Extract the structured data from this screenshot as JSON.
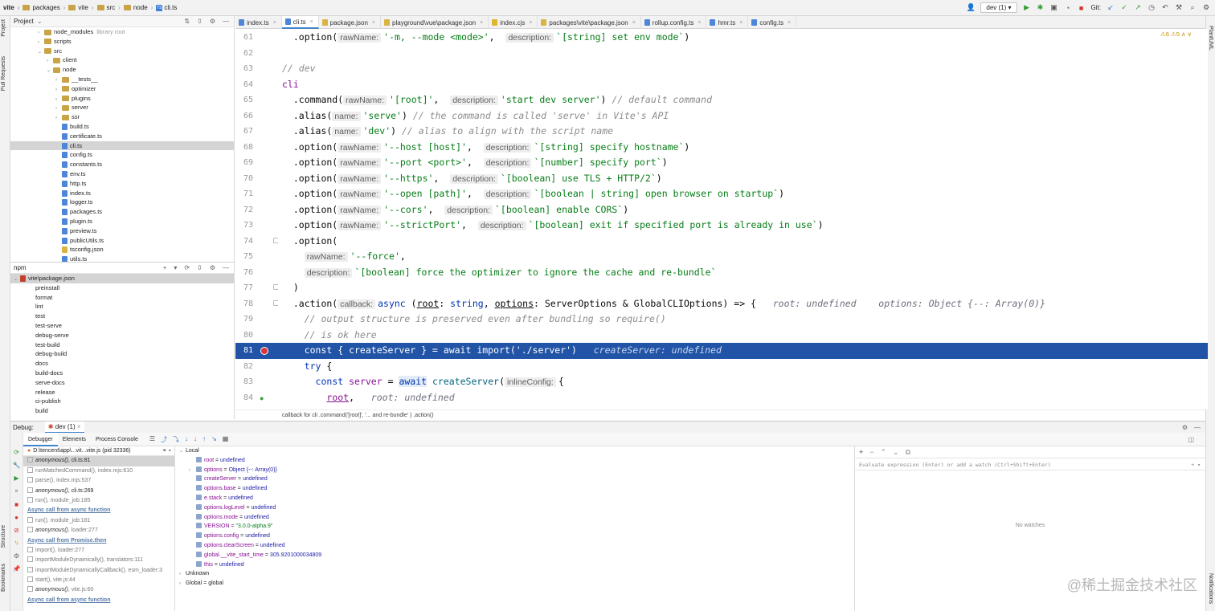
{
  "breadcrumb": [
    "vite",
    "packages",
    "vite",
    "src",
    "node",
    "cli.ts"
  ],
  "run_config": "dev (1)",
  "git_label": "Git:",
  "left_strip": {
    "project": "Project",
    "pull_requests": "Pull Requests",
    "structure": "Structure",
    "bookmarks": "Bookmarks"
  },
  "right_strip": {
    "plantuml": "PlantUML",
    "notifications": "Notifications"
  },
  "project_panel": {
    "title": "Project",
    "rows": [
      {
        "label": "node_modules",
        "extra": "library root",
        "depth": 4,
        "type": "folder",
        "arrow": "›"
      },
      {
        "label": "scripts",
        "depth": 4,
        "type": "folder",
        "arrow": "›"
      },
      {
        "label": "src",
        "depth": 4,
        "type": "folder",
        "arrow": "⌄"
      },
      {
        "label": "client",
        "depth": 5,
        "type": "folder",
        "arrow": "›"
      },
      {
        "label": "node",
        "depth": 5,
        "type": "folder",
        "arrow": "⌄"
      },
      {
        "label": "__tests__",
        "depth": 6,
        "type": "folder",
        "arrow": "›"
      },
      {
        "label": "optimizer",
        "depth": 6,
        "type": "folder",
        "arrow": "›"
      },
      {
        "label": "plugins",
        "depth": 6,
        "type": "folder",
        "arrow": "›"
      },
      {
        "label": "server",
        "depth": 6,
        "type": "folder",
        "arrow": "›"
      },
      {
        "label": "ssr",
        "depth": 6,
        "type": "folder",
        "arrow": "›"
      },
      {
        "label": "build.ts",
        "depth": 6,
        "type": "ts"
      },
      {
        "label": "certificate.ts",
        "depth": 6,
        "type": "ts"
      },
      {
        "label": "cli.ts",
        "depth": 6,
        "type": "ts",
        "selected": true
      },
      {
        "label": "config.ts",
        "depth": 6,
        "type": "ts"
      },
      {
        "label": "constants.ts",
        "depth": 6,
        "type": "ts"
      },
      {
        "label": "env.ts",
        "depth": 6,
        "type": "ts"
      },
      {
        "label": "http.ts",
        "depth": 6,
        "type": "ts"
      },
      {
        "label": "index.ts",
        "depth": 6,
        "type": "ts"
      },
      {
        "label": "logger.ts",
        "depth": 6,
        "type": "ts"
      },
      {
        "label": "packages.ts",
        "depth": 6,
        "type": "ts"
      },
      {
        "label": "plugin.ts",
        "depth": 6,
        "type": "ts"
      },
      {
        "label": "preview.ts",
        "depth": 6,
        "type": "ts"
      },
      {
        "label": "publicUtils.ts",
        "depth": 6,
        "type": "ts"
      },
      {
        "label": "tsconfig.json",
        "depth": 6,
        "type": "json"
      },
      {
        "label": "utils.ts",
        "depth": 6,
        "type": "ts"
      }
    ]
  },
  "npm_panel": {
    "title": "npm",
    "root": "vite\\package.json",
    "scripts": [
      "preinstall",
      "format",
      "lint",
      "test",
      "test-serve",
      "debug-serve",
      "test-build",
      "debug-build",
      "docs",
      "build-docs",
      "serve-docs",
      "release",
      "ci-publish",
      "build"
    ]
  },
  "tabs": [
    {
      "label": "index.ts",
      "icon": "ts"
    },
    {
      "label": "cli.ts",
      "icon": "ts",
      "active": true
    },
    {
      "label": "package.json",
      "icon": "json"
    },
    {
      "label": "playground\\vue\\package.json",
      "icon": "json"
    },
    {
      "label": "index.cjs",
      "icon": "js"
    },
    {
      "label": "packages\\vite\\package.json",
      "icon": "json"
    },
    {
      "label": "rollup.config.ts",
      "icon": "ts"
    },
    {
      "label": "hmr.ts",
      "icon": "ts"
    },
    {
      "label": "config.ts",
      "icon": "ts"
    }
  ],
  "editor": {
    "warnings": "⚠6  ⚠5  ∧  ∨",
    "line_numbers": [
      "61",
      "62",
      "63",
      "64",
      "65",
      "66",
      "67",
      "68",
      "69",
      "70",
      "71",
      "72",
      "73",
      "74",
      "75",
      "76",
      "77",
      "78",
      "79",
      "80",
      "81",
      "82",
      "83",
      "84"
    ],
    "breakpoint_line": "81",
    "breadcrumb_footer": "callback for cli .command('[root]', '... and re-bundle' ) .action()"
  },
  "debug": {
    "label": "Debug:",
    "session": "dev (1)",
    "tabs": [
      "Debugger",
      "Elements",
      "Process Console"
    ],
    "thread": "D:\\tencent\\app\\...vit...vite.js (pid 32336)",
    "frames": [
      {
        "fn": "anonymous()",
        "loc": ", cli.ts:81",
        "italic": true,
        "current": true
      },
      {
        "fn": "runMatchedCommand()",
        "loc": ", index.mjs:610"
      },
      {
        "fn": "parse()",
        "loc": ", index.mjs:537"
      },
      {
        "fn": "anonymous()",
        "loc": ", cli.ts:269",
        "italic": true,
        "dark": true
      },
      {
        "fn": "run()",
        "loc": ", module_job:185"
      },
      {
        "async": "Async call from async function"
      },
      {
        "fn": "run()",
        "loc": ", module_job:181"
      },
      {
        "fn": "anonymous()",
        "loc": ", loader:277",
        "italic": true
      },
      {
        "async": "Async call from Promise.then"
      },
      {
        "fn": "import()",
        "loc": ", loader:277"
      },
      {
        "fn": "importModuleDynamically()",
        "loc": ", translators:111"
      },
      {
        "fn": "importModuleDynamicallyCallback()",
        "loc": ", esm_loader:3"
      },
      {
        "fn": "start()",
        "loc": ", vite.js:44"
      },
      {
        "fn": "anonymous()",
        "loc": ", vite.js:60",
        "italic": true
      },
      {
        "async": "Async call from async function"
      }
    ],
    "variables_header": "Local",
    "variables": [
      {
        "name": "root",
        "value": "undefined"
      },
      {
        "name": "options",
        "value": "Object {--: Array(0)}",
        "expandable": true
      },
      {
        "name": "createServer",
        "value": "undefined"
      },
      {
        "name": "options.base",
        "value": "undefined"
      },
      {
        "name": "e.stack",
        "value": "undefined"
      },
      {
        "name": "options.logLevel",
        "value": "undefined"
      },
      {
        "name": "options.mode",
        "value": "undefined"
      },
      {
        "name": "VERSION",
        "value": "\"3.0.0-alpha.9\"",
        "string": true
      },
      {
        "name": "options.config",
        "value": "undefined"
      },
      {
        "name": "options.clearScreen",
        "value": "undefined"
      },
      {
        "name": "global.__vite_start_time",
        "value": "305.9201000034809"
      },
      {
        "name": "this",
        "value": "undefined"
      }
    ],
    "scopes": [
      "Unknown",
      "Global = global"
    ],
    "watch_placeholder": "Evaluate expression (Enter) or add a watch (Ctrl+Shift+Enter)",
    "no_watches": "No watches"
  },
  "watermark": "@稀土掘金技术社区"
}
